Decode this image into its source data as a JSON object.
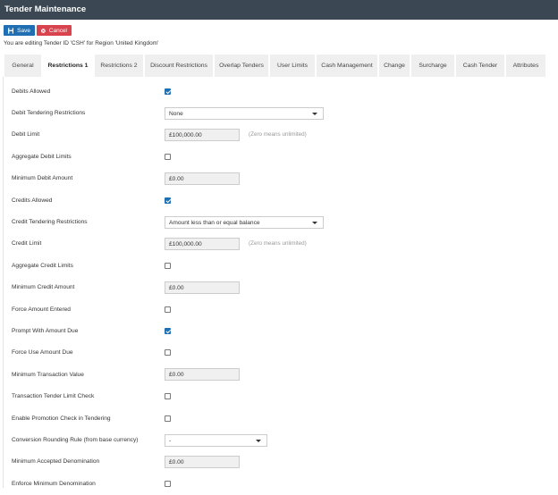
{
  "header": {
    "title": "Tender Maintenance"
  },
  "toolbar": {
    "save_label": "Save",
    "cancel_label": "Cancel"
  },
  "info_text": "You are editing Tender ID 'CSH' for Region 'United Kingdom'",
  "tabs": [
    {
      "label": "General"
    },
    {
      "label": "Restrictions 1",
      "active": true
    },
    {
      "label": "Restrictions 2"
    },
    {
      "label": "Discount Restrictions"
    },
    {
      "label": "Overlap Tenders"
    },
    {
      "label": "User Limits"
    },
    {
      "label": "Cash Management"
    },
    {
      "label": "Change"
    },
    {
      "label": "Surcharge"
    },
    {
      "label": "Cash Tender"
    },
    {
      "label": "Attributes"
    }
  ],
  "fields": [
    {
      "label": "Debits Allowed",
      "type": "checkbox",
      "checked": true
    },
    {
      "label": "Debit Tendering Restrictions",
      "type": "select",
      "value": "None",
      "wide": true
    },
    {
      "label": "Debit Limit",
      "type": "input",
      "value": "£100,000.00",
      "hint": "(Zero means unlimited)"
    },
    {
      "label": "Aggregate Debit Limits",
      "type": "checkbox",
      "checked": false
    },
    {
      "label": "Minimum Debit Amount",
      "type": "input",
      "value": "£0.00"
    },
    {
      "label": "Credits Allowed",
      "type": "checkbox",
      "checked": true
    },
    {
      "label": "Credit Tendering Restrictions",
      "type": "select",
      "value": "Amount less than or equal balance",
      "wide": true
    },
    {
      "label": "Credit Limit",
      "type": "input",
      "value": "£100,000.00",
      "hint": "(Zero means unlimited)"
    },
    {
      "label": "Aggregate Credit Limits",
      "type": "checkbox",
      "checked": false
    },
    {
      "label": "Minimum Credit Amount",
      "type": "input",
      "value": "£0.00"
    },
    {
      "label": "Force Amount Entered",
      "type": "checkbox",
      "checked": false
    },
    {
      "label": "Prompt With Amount Due",
      "type": "checkbox",
      "checked": true
    },
    {
      "label": "Force Use Amount Due",
      "type": "checkbox",
      "checked": false
    },
    {
      "label": "Minimum Transaction Value",
      "type": "input",
      "value": "£0.00"
    },
    {
      "label": "Transaction Tender Limit Check",
      "type": "checkbox",
      "checked": false
    },
    {
      "label": "Enable Promotion Check in Tendering",
      "type": "checkbox",
      "checked": false
    },
    {
      "label": "Conversion Rounding Rule (from base currency)",
      "type": "select",
      "value": "-",
      "wide": false
    },
    {
      "label": "Minimum Accepted Denomination",
      "type": "input",
      "value": "£0.00"
    },
    {
      "label": "Enforce Minimum Denomination",
      "type": "checkbox",
      "checked": false
    }
  ]
}
